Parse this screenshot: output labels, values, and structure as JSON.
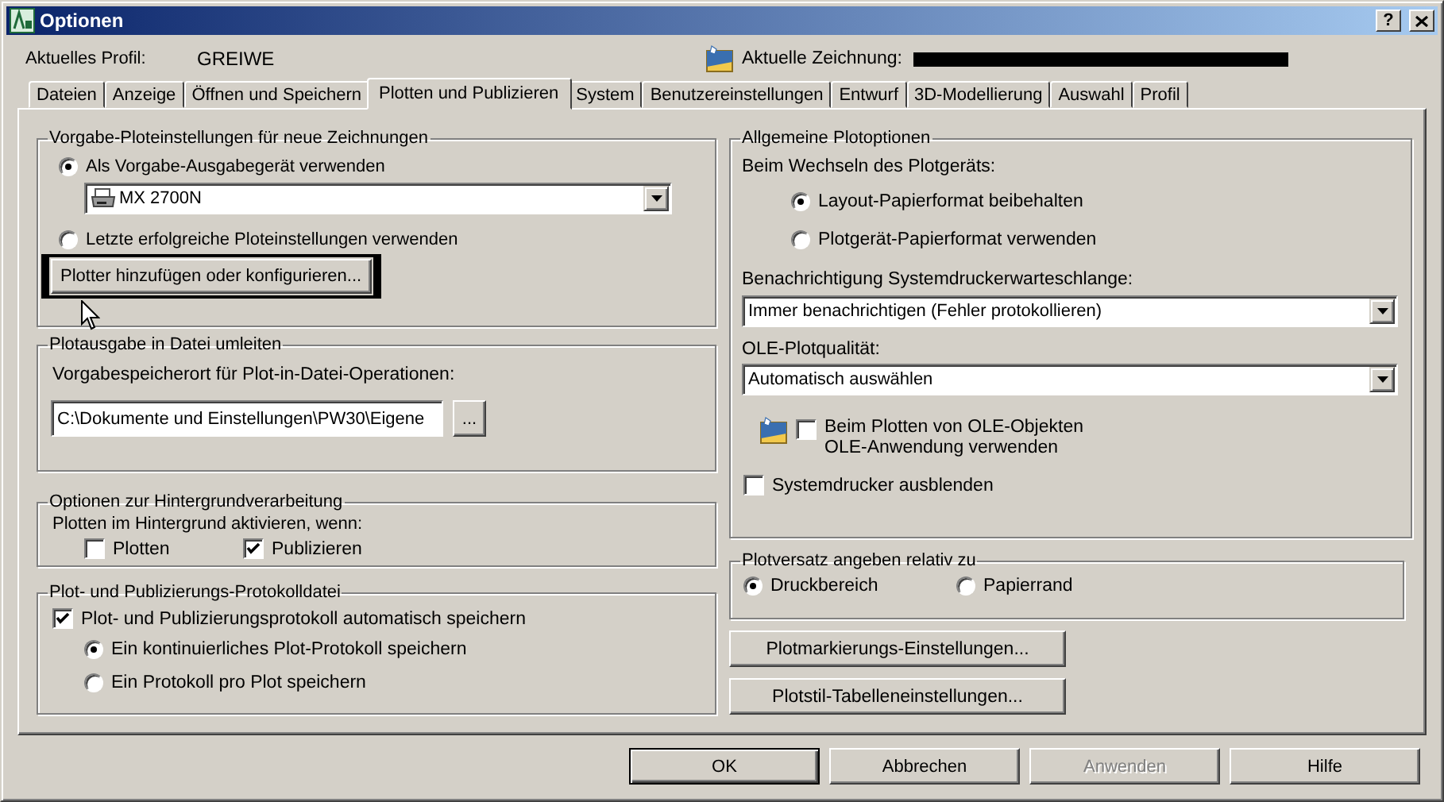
{
  "window": {
    "title": "Optionen",
    "help_glyph": "?"
  },
  "profile": {
    "label": "Aktuelles Profil:",
    "value": "GREIWE"
  },
  "drawing": {
    "label": "Aktuelle Zeichnung:",
    "redacted": true
  },
  "tabs": [
    {
      "label": "Dateien",
      "selected": false
    },
    {
      "label": "Anzeige",
      "selected": false
    },
    {
      "label": "Öffnen und Speichern",
      "selected": false
    },
    {
      "label": "Plotten und Publizieren",
      "selected": true
    },
    {
      "label": "System",
      "selected": false
    },
    {
      "label": "Benutzereinstellungen",
      "selected": false
    },
    {
      "label": "Entwurf",
      "selected": false
    },
    {
      "label": "3D-Modellierung",
      "selected": false
    },
    {
      "label": "Auswahl",
      "selected": false
    },
    {
      "label": "Profil",
      "selected": false
    }
  ],
  "default_plot": {
    "title": "Vorgabe-Ploteinstellungen für neue Zeichnungen",
    "options": [
      {
        "label": "Als Vorgabe-Ausgabegerät verwenden",
        "selected": true
      },
      {
        "label": "Letzte erfolgreiche Ploteinstellungen verwenden",
        "selected": false
      }
    ],
    "device": "MX 2700N",
    "button": "Plotter hinzufügen oder konfigurieren..."
  },
  "plot_to_file": {
    "title": "Plotausgabe in Datei umleiten",
    "label": "Vorgabespeicherort für Plot-in-Datei-Operationen:",
    "path": "C:\\Dokumente und Einstellungen\\PW30\\Eigene",
    "browse_button": "..."
  },
  "background": {
    "title": "Optionen zur Hintergrundverarbeitung",
    "label": "Plotten im Hintergrund aktivieren, wenn:",
    "checks": [
      {
        "label": "Plotten",
        "checked": false
      },
      {
        "label": "Publizieren",
        "checked": true
      }
    ]
  },
  "log": {
    "title": "Plot- und Publizierungs-Protokolldatei",
    "auto_save": {
      "label": "Plot- und Publizierungsprotokoll automatisch speichern",
      "checked": true
    },
    "options": [
      {
        "label": "Ein kontinuierliches Plot-Protokoll speichern",
        "selected": true
      },
      {
        "label": "Ein Protokoll pro Plot speichern",
        "selected": false
      }
    ]
  },
  "general": {
    "title": "Allgemeine Plotoptionen",
    "device_change_label": "Beim Wechseln des Plotgeräts:",
    "device_change_options": [
      {
        "label": "Layout-Papierformat beibehalten",
        "selected": true
      },
      {
        "label": "Plotgerät-Papierformat verwenden",
        "selected": false
      }
    ],
    "spooler_label": "Benachrichtigung Systemdruckerwarteschlange:",
    "spooler": "Immer benachrichtigen (Fehler protokollieren)",
    "ole_quality_label": "OLE-Plotqualität:",
    "ole_quality": "Automatisch auswählen",
    "ole_app": {
      "label_lines": [
        "Beim Plotten von OLE-Objekten",
        "OLE-Anwendung verwenden"
      ],
      "checked": false
    },
    "hide_system_printers": {
      "label": "Systemdrucker ausblenden",
      "checked": false
    }
  },
  "offset": {
    "title": "Plotversatz angeben relativ zu",
    "options": [
      {
        "label": "Druckbereich",
        "selected": true
      },
      {
        "label": "Papierrand",
        "selected": false
      }
    ]
  },
  "panel_buttons": [
    "Plotmarkierungs-Einstellungen...",
    "Plotstil-Tabelleneinstellungen..."
  ],
  "buttons": [
    {
      "label": "OK",
      "default": true,
      "disabled": false
    },
    {
      "label": "Abbrechen",
      "default": false,
      "disabled": false
    },
    {
      "label": "Anwenden",
      "default": false,
      "disabled": true
    },
    {
      "label": "Hilfe",
      "default": false,
      "disabled": false
    }
  ]
}
